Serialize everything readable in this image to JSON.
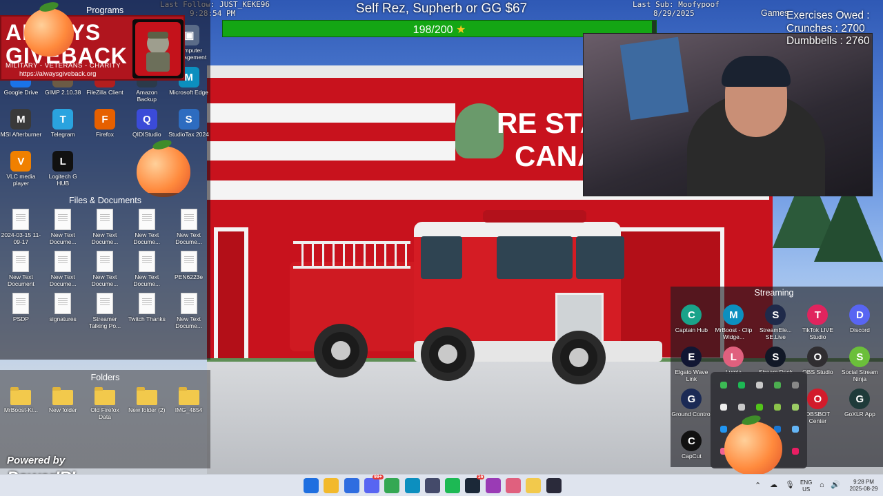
{
  "overlay": {
    "last_follow": "Last Follow: JUST_KEKE96",
    "last_sub": "Last Sub: Moofypoof",
    "time": "9:28:54 PM",
    "date": "8/29/2025",
    "goal_title": "Self Rez, Supherb or GG $67",
    "goal_label": "198/200",
    "goal_progress": 0.99,
    "exercises_title": "Exercises Owed :",
    "crunches": "Crunches : 2700",
    "dumbbells": "Dumbbells : 2760",
    "powered_by": "Powered by",
    "powerirl": "PowerIRL"
  },
  "scene": {
    "sign_line1": "RE STA",
    "sign_line2": "CANA"
  },
  "promo": {
    "big": "ALWAYS GIVEBACK",
    "tagline": "MILITARY - VETERANS - CHARITY",
    "url": "https://alwaysgiveback.org"
  },
  "panels": {
    "programs_title": "Programs",
    "files_title": "Files & Documents",
    "folders_title": "Folders",
    "streaming_title": "Streaming",
    "games_title": "Games"
  },
  "programs": [
    {
      "label": "Google Drive",
      "icon": "google-drive-icon",
      "color": "#1a73e8"
    },
    {
      "label": "GIMP 2.10.38",
      "icon": "gimp-icon",
      "color": "#6b5b45"
    },
    {
      "label": "FileZilla Client",
      "icon": "filezilla-icon",
      "color": "#b21e1e"
    },
    {
      "label": "Amazon Backup",
      "icon": "amazon-backup-icon",
      "color": "#2b3a4a"
    },
    {
      "label": "Microsoft Edge",
      "icon": "edge-icon",
      "color": "#0c8fbf"
    },
    {
      "label": "MSI Afterburner",
      "icon": "msi-afterburner-icon",
      "color": "#3a3a3a"
    },
    {
      "label": "Telegram",
      "icon": "telegram-icon",
      "color": "#2aa3df"
    },
    {
      "label": "Firefox",
      "icon": "firefox-icon",
      "color": "#e66000"
    },
    {
      "label": "QIDIStudio",
      "icon": "qidistudio-icon",
      "color": "#3b4bd8"
    },
    {
      "label": "StudioTax 2024",
      "icon": "studiotax-icon",
      "color": "#2d6cc0"
    },
    {
      "label": "VLC media player",
      "icon": "vlc-icon",
      "color": "#f08000"
    },
    {
      "label": "Logitech G HUB",
      "icon": "logitech-ghub-icon",
      "color": "#111111"
    }
  ],
  "program_partial": {
    "label": "Computer Management"
  },
  "files": [
    {
      "label": "2024-03-15 11-09-17"
    },
    {
      "label": "New Text Docume..."
    },
    {
      "label": "New Text Docume..."
    },
    {
      "label": "New Text Docume..."
    },
    {
      "label": "New Text Docume..."
    },
    {
      "label": "New Text Document"
    },
    {
      "label": "New Text Docume..."
    },
    {
      "label": "New Text Docume..."
    },
    {
      "label": "New Text Docume..."
    },
    {
      "label": "PEN6223e"
    },
    {
      "label": "PSDP"
    },
    {
      "label": "signatures"
    },
    {
      "label": "Streamer Talking Po..."
    },
    {
      "label": "Twitch Thanks"
    },
    {
      "label": "New Text Docume..."
    }
  ],
  "folders": [
    {
      "label": "MrBoost-Ki..."
    },
    {
      "label": "New folder"
    },
    {
      "label": "Old Firefox Data"
    },
    {
      "label": "New folder (2)"
    },
    {
      "label": "IMG_4854"
    }
  ],
  "streaming": [
    {
      "label": "Captain Hub",
      "icon": "captain-hub-icon",
      "color": "#1aa38a"
    },
    {
      "label": "MrBoost - Clip Widge...",
      "icon": "edge-icon",
      "color": "#0c8fbf"
    },
    {
      "label": "StreamEle... SE.Live",
      "icon": "streamelements-icon",
      "color": "#1f2a4a"
    },
    {
      "label": "TikTok LIVE Studio",
      "icon": "tiktok-icon",
      "color": "#e0245e"
    },
    {
      "label": "Discord",
      "icon": "discord-icon",
      "color": "#5865f2"
    },
    {
      "label": "Elgato Wave Link",
      "icon": "wave-link-icon",
      "color": "#111633"
    },
    {
      "label": "Lumia",
      "icon": "lumia-icon",
      "color": "#e0607e"
    },
    {
      "label": "Stream Deck",
      "icon": "stream-deck-icon",
      "color": "#111827"
    },
    {
      "label": "OBS Studio",
      "icon": "obs-icon",
      "color": "#302e31"
    },
    {
      "label": "Social Stream Ninja",
      "icon": "social-stream-ninja-icon",
      "color": "#6bbf3a"
    },
    {
      "label": "Ground Control",
      "icon": "ground-control-icon",
      "color": "#1b2a55"
    },
    {
      "label": "",
      "icon": "",
      "color": ""
    },
    {
      "label": "",
      "icon": "",
      "color": ""
    },
    {
      "label": "OBSBOT Center",
      "icon": "obsbot-icon",
      "color": "#d21b2b"
    },
    {
      "label": "GoXLR App",
      "icon": "goxlr-icon",
      "color": "#1f3b3a"
    },
    {
      "label": "CapCut",
      "icon": "capcut-icon",
      "color": "#111111"
    }
  ],
  "taskbar": {
    "lang": "ENG",
    "region": "US",
    "clock_time": "9:28 PM",
    "clock_date": "2025-08-29",
    "badge_discord": "99+",
    "badge_steam": "16",
    "icons": [
      {
        "name": "start-icon",
        "color": "#1f6fe0"
      },
      {
        "name": "file-explorer-icon",
        "color": "#f2b92c"
      },
      {
        "name": "microsoft-store-icon",
        "color": "#2f6de0"
      },
      {
        "name": "discord-icon",
        "color": "#5865f2"
      },
      {
        "name": "chrome-icon",
        "color": "#34a853"
      },
      {
        "name": "edge-icon",
        "color": "#0c8fbf"
      },
      {
        "name": "mcl-icon",
        "color": "#444a6a"
      },
      {
        "name": "spotify-icon",
        "color": "#1db954"
      },
      {
        "name": "steam-icon",
        "color": "#1b2838"
      },
      {
        "name": "app-icon",
        "color": "#9a3bb5"
      },
      {
        "name": "lumia-icon",
        "color": "#e0607e"
      },
      {
        "name": "game-icon",
        "color": "#f2c94c"
      },
      {
        "name": "arrow-app-icon",
        "color": "#2a2a3a"
      }
    ]
  }
}
